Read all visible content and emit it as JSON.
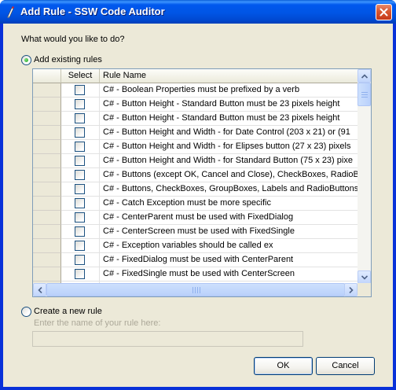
{
  "window": {
    "title": "Add Rule - SSW Code Auditor"
  },
  "prompt": "What would you like to do?",
  "options": {
    "add_existing": {
      "label": "Add existing rules",
      "checked": true
    },
    "create_new": {
      "label": "Create a new rule",
      "checked": false
    }
  },
  "grid": {
    "columns": {
      "select": "Select",
      "rule_name": "Rule Name"
    },
    "rows": [
      {
        "selected": false,
        "name": "C# - Boolean Properties must be prefixed by a verb"
      },
      {
        "selected": false,
        "name": "C# - Button Height - Standard Button must be 23 pixels height"
      },
      {
        "selected": false,
        "name": "C# - Button Height - Standard Button must be 23 pixels height"
      },
      {
        "selected": false,
        "name": "C# - Button Height and Width - for Date Control (203 x 21) or (91"
      },
      {
        "selected": false,
        "name": "C# - Button Height and Width - for Elipses button (27 x 23) pixels"
      },
      {
        "selected": false,
        "name": "C# - Button Height and Width - for Standard Button (75 x 23) pixe"
      },
      {
        "selected": false,
        "name": "C# - Buttons (except OK, Cancel and Close), CheckBoxes, RadioBu"
      },
      {
        "selected": false,
        "name": "C# - Buttons, CheckBoxes, GroupBoxes, Labels and RadioButtons"
      },
      {
        "selected": false,
        "name": "C# - Catch Exception must be more specific"
      },
      {
        "selected": false,
        "name": "C# - CenterParent must be used with FixedDialog"
      },
      {
        "selected": false,
        "name": "C# - CenterScreen must be used with FixedSingle"
      },
      {
        "selected": false,
        "name": "C# - Exception variables should be called ex"
      },
      {
        "selected": false,
        "name": "C# - FixedDialog must be used with CenterParent"
      },
      {
        "selected": false,
        "name": "C# - FixedSingle must be used with CenterScreen"
      },
      {
        "selected": false,
        "name": ""
      }
    ]
  },
  "new_rule": {
    "prompt": "Enter the name of your rule here:",
    "value": ""
  },
  "buttons": {
    "ok": "OK",
    "cancel": "Cancel"
  },
  "colors": {
    "title_bar": "#0054e3",
    "dialog_bg": "#ece9d8",
    "close_button": "#d8562f",
    "disabled_text": "#aca899"
  }
}
